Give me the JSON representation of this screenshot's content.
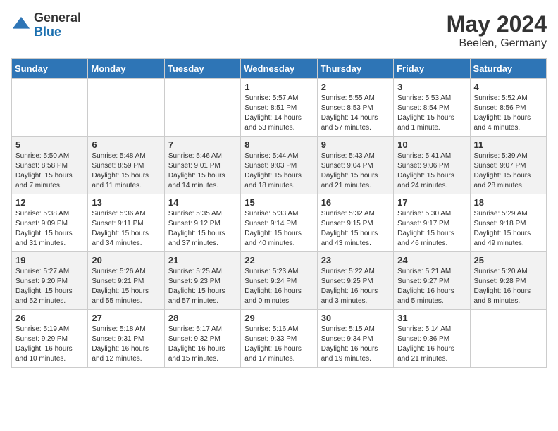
{
  "header": {
    "logo": {
      "general": "General",
      "blue": "Blue"
    },
    "title": "May 2024",
    "location": "Beelen, Germany"
  },
  "weekdays": [
    "Sunday",
    "Monday",
    "Tuesday",
    "Wednesday",
    "Thursday",
    "Friday",
    "Saturday"
  ],
  "weeks": [
    [
      {
        "day": "",
        "info": ""
      },
      {
        "day": "",
        "info": ""
      },
      {
        "day": "",
        "info": ""
      },
      {
        "day": "1",
        "info": "Sunrise: 5:57 AM\nSunset: 8:51 PM\nDaylight: 14 hours\nand 53 minutes."
      },
      {
        "day": "2",
        "info": "Sunrise: 5:55 AM\nSunset: 8:53 PM\nDaylight: 14 hours\nand 57 minutes."
      },
      {
        "day": "3",
        "info": "Sunrise: 5:53 AM\nSunset: 8:54 PM\nDaylight: 15 hours\nand 1 minute."
      },
      {
        "day": "4",
        "info": "Sunrise: 5:52 AM\nSunset: 8:56 PM\nDaylight: 15 hours\nand 4 minutes."
      }
    ],
    [
      {
        "day": "5",
        "info": "Sunrise: 5:50 AM\nSunset: 8:58 PM\nDaylight: 15 hours\nand 7 minutes."
      },
      {
        "day": "6",
        "info": "Sunrise: 5:48 AM\nSunset: 8:59 PM\nDaylight: 15 hours\nand 11 minutes."
      },
      {
        "day": "7",
        "info": "Sunrise: 5:46 AM\nSunset: 9:01 PM\nDaylight: 15 hours\nand 14 minutes."
      },
      {
        "day": "8",
        "info": "Sunrise: 5:44 AM\nSunset: 9:03 PM\nDaylight: 15 hours\nand 18 minutes."
      },
      {
        "day": "9",
        "info": "Sunrise: 5:43 AM\nSunset: 9:04 PM\nDaylight: 15 hours\nand 21 minutes."
      },
      {
        "day": "10",
        "info": "Sunrise: 5:41 AM\nSunset: 9:06 PM\nDaylight: 15 hours\nand 24 minutes."
      },
      {
        "day": "11",
        "info": "Sunrise: 5:39 AM\nSunset: 9:07 PM\nDaylight: 15 hours\nand 28 minutes."
      }
    ],
    [
      {
        "day": "12",
        "info": "Sunrise: 5:38 AM\nSunset: 9:09 PM\nDaylight: 15 hours\nand 31 minutes."
      },
      {
        "day": "13",
        "info": "Sunrise: 5:36 AM\nSunset: 9:11 PM\nDaylight: 15 hours\nand 34 minutes."
      },
      {
        "day": "14",
        "info": "Sunrise: 5:35 AM\nSunset: 9:12 PM\nDaylight: 15 hours\nand 37 minutes."
      },
      {
        "day": "15",
        "info": "Sunrise: 5:33 AM\nSunset: 9:14 PM\nDaylight: 15 hours\nand 40 minutes."
      },
      {
        "day": "16",
        "info": "Sunrise: 5:32 AM\nSunset: 9:15 PM\nDaylight: 15 hours\nand 43 minutes."
      },
      {
        "day": "17",
        "info": "Sunrise: 5:30 AM\nSunset: 9:17 PM\nDaylight: 15 hours\nand 46 minutes."
      },
      {
        "day": "18",
        "info": "Sunrise: 5:29 AM\nSunset: 9:18 PM\nDaylight: 15 hours\nand 49 minutes."
      }
    ],
    [
      {
        "day": "19",
        "info": "Sunrise: 5:27 AM\nSunset: 9:20 PM\nDaylight: 15 hours\nand 52 minutes."
      },
      {
        "day": "20",
        "info": "Sunrise: 5:26 AM\nSunset: 9:21 PM\nDaylight: 15 hours\nand 55 minutes."
      },
      {
        "day": "21",
        "info": "Sunrise: 5:25 AM\nSunset: 9:23 PM\nDaylight: 15 hours\nand 57 minutes."
      },
      {
        "day": "22",
        "info": "Sunrise: 5:23 AM\nSunset: 9:24 PM\nDaylight: 16 hours\nand 0 minutes."
      },
      {
        "day": "23",
        "info": "Sunrise: 5:22 AM\nSunset: 9:25 PM\nDaylight: 16 hours\nand 3 minutes."
      },
      {
        "day": "24",
        "info": "Sunrise: 5:21 AM\nSunset: 9:27 PM\nDaylight: 16 hours\nand 5 minutes."
      },
      {
        "day": "25",
        "info": "Sunrise: 5:20 AM\nSunset: 9:28 PM\nDaylight: 16 hours\nand 8 minutes."
      }
    ],
    [
      {
        "day": "26",
        "info": "Sunrise: 5:19 AM\nSunset: 9:29 PM\nDaylight: 16 hours\nand 10 minutes."
      },
      {
        "day": "27",
        "info": "Sunrise: 5:18 AM\nSunset: 9:31 PM\nDaylight: 16 hours\nand 12 minutes."
      },
      {
        "day": "28",
        "info": "Sunrise: 5:17 AM\nSunset: 9:32 PM\nDaylight: 16 hours\nand 15 minutes."
      },
      {
        "day": "29",
        "info": "Sunrise: 5:16 AM\nSunset: 9:33 PM\nDaylight: 16 hours\nand 17 minutes."
      },
      {
        "day": "30",
        "info": "Sunrise: 5:15 AM\nSunset: 9:34 PM\nDaylight: 16 hours\nand 19 minutes."
      },
      {
        "day": "31",
        "info": "Sunrise: 5:14 AM\nSunset: 9:36 PM\nDaylight: 16 hours\nand 21 minutes."
      },
      {
        "day": "",
        "info": ""
      }
    ]
  ]
}
